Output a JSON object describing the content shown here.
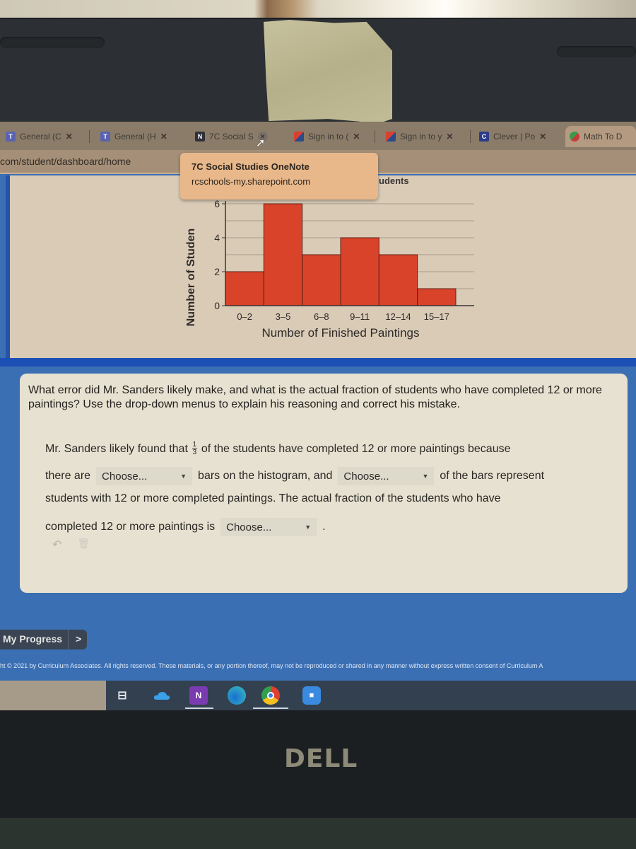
{
  "browser": {
    "tabs": [
      {
        "label": "General (C",
        "icon": "teams-icon",
        "closable": true
      },
      {
        "label": "General (H",
        "icon": "teams-icon",
        "closable": true
      },
      {
        "label": "7C Social S",
        "icon": "onenote-icon",
        "closable": true,
        "active": true
      },
      {
        "label": "Sign in to (",
        "icon": "office-icon",
        "closable": true
      },
      {
        "label": "Sign in to y",
        "icon": "office-icon",
        "closable": true
      },
      {
        "label": "Clever | Po",
        "icon": "clever-icon",
        "closable": true
      },
      {
        "label": "Math To D",
        "icon": "math-icon",
        "closable": false
      }
    ],
    "address": "com/student/dashboard/home",
    "tooltip": {
      "title": "7C Social Studies OneNote",
      "url": "rcschools-my.sharepoint.com"
    }
  },
  "chart_title_fragment": "udents",
  "chart_data": {
    "type": "bar",
    "title": "",
    "xlabel": "Number of Finished Paintings",
    "ylabel": "Number of Studen",
    "categories": [
      "0–2",
      "3–5",
      "6–8",
      "9–11",
      "12–14",
      "15–17"
    ],
    "values": [
      2,
      6,
      3,
      4,
      3,
      1
    ],
    "ylim": [
      0,
      6
    ],
    "yticks": [
      0,
      2,
      4,
      6
    ],
    "grid": true,
    "bar_color": "#d8432a",
    "legend": "none"
  },
  "question": {
    "prompt": "What error did Mr. Sanders likely make, and what is the actual fraction of students who have completed 12 or more paintings? Use the drop-down menus to explain his reasoning and correct his mistake.",
    "line1_before": "Mr. Sanders likely found that",
    "fraction_num": "1",
    "fraction_den": "3",
    "line1_after": "of the students have completed 12 or more paintings because",
    "line2_a": "there are",
    "line2_b": "bars on the histogram, and",
    "line2_c": "of the bars represent",
    "line3": "students with 12 or more completed paintings. The actual fraction of the students who have",
    "line4_a": "completed 12 or more paintings is",
    "line4_end": ".",
    "dropdowns": [
      {
        "value": "Choose..."
      },
      {
        "value": "Choose..."
      },
      {
        "value": "Choose..."
      }
    ],
    "tools": {
      "undo_icon": "↶",
      "trash_icon": "🗑"
    }
  },
  "progress_button": {
    "label": "My Progress",
    "chevron": ">"
  },
  "copyright": "ht © 2021 by Curriculum Associates. All rights reserved. These materials, or any portion thereof, may not be reproduced or shared in any manner without express written consent of Curriculum A",
  "taskbar": {
    "items": [
      "task-view",
      "onedrive",
      "onenote",
      "edge",
      "chrome",
      "zoom"
    ],
    "onenote_letter": "N"
  },
  "brand": "DELL",
  "colors": {
    "accent_blue": "#1c4fb3",
    "bar": "#d8432a",
    "tooltip_bg": "#e8b88a"
  }
}
